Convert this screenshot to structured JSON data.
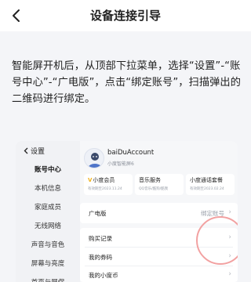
{
  "header": {
    "title": "设备连接引导",
    "back_icon": "chevron-left-icon"
  },
  "instruction": {
    "text": "智能屏开机后，从顶部下拉菜单，选择“设置”-“账号中心”-“广电版”，点击“绑定账号”，扫描弹出的二维码进行绑定。"
  },
  "screenshot": {
    "sidebar": {
      "back_label": "设置",
      "items": [
        {
          "label": "账号中心",
          "active": true
        },
        {
          "label": "本机信息"
        },
        {
          "label": "家庭成员"
        },
        {
          "label": "无线网络"
        },
        {
          "label": "声音与音色"
        },
        {
          "label": "屏幕与亮度"
        },
        {
          "label": "首页与屏保"
        }
      ]
    },
    "account": {
      "name": "baiDuAccount",
      "subtitle": "小度智能屏6"
    },
    "cards": [
      {
        "title": "小度会员",
        "sub": "有效期至2023.11.24",
        "vip": true
      },
      {
        "title": "音乐服务",
        "sub": "QQ音乐/酷狗/酷我"
      },
      {
        "title": "小度通话套餐",
        "sub": "有效期至2023.02.24"
      }
    ],
    "rows": {
      "broadcast_label": "广电版",
      "broadcast_value": "绑定账号",
      "purchase": "购买记录",
      "coupons": "我的券码",
      "coins": "我的小度币"
    }
  },
  "colors": {
    "accent_highlight": "#f2a1a1",
    "vip_gold": "#f0b21b",
    "page_bg": "#f4f5f8"
  }
}
